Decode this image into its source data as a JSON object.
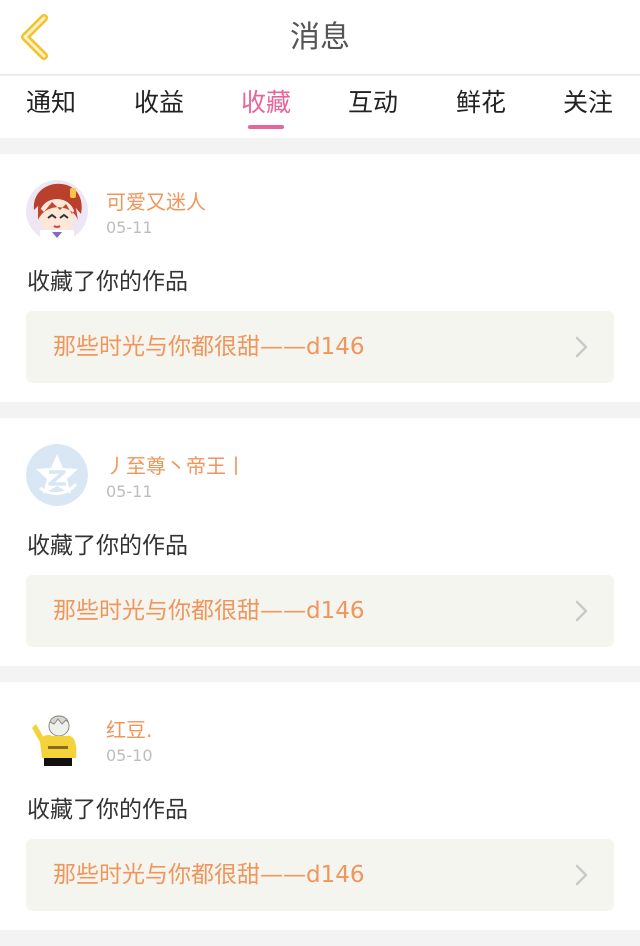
{
  "header": {
    "title": "消息",
    "back_icon": "chevron-left-icon",
    "accent": "#e8659c",
    "back_color": "#f2c230"
  },
  "tabs": [
    {
      "label": "通知",
      "active": false
    },
    {
      "label": "收益",
      "active": false
    },
    {
      "label": "收藏",
      "active": true
    },
    {
      "label": "互动",
      "active": false
    },
    {
      "label": "鲜花",
      "active": false
    },
    {
      "label": "关注",
      "active": false
    }
  ],
  "messages": [
    {
      "user": "可爱又迷人",
      "date": "05-11",
      "action": "收藏了你的作品",
      "work": "那些时光与你都很甜——d146",
      "avatar_icon": "anime-girl-avatar"
    },
    {
      "user": "丿至尊丶帝王丨",
      "date": "05-11",
      "action": "收藏了你的作品",
      "work": "那些时光与你都很甜——d146",
      "avatar_icon": "qzone-star-avatar"
    },
    {
      "user": "红豆.",
      "date": "05-10",
      "action": "收藏了你的作品",
      "work": "那些时光与你都很甜——d146",
      "avatar_icon": "yellow-sweater-avatar"
    }
  ]
}
